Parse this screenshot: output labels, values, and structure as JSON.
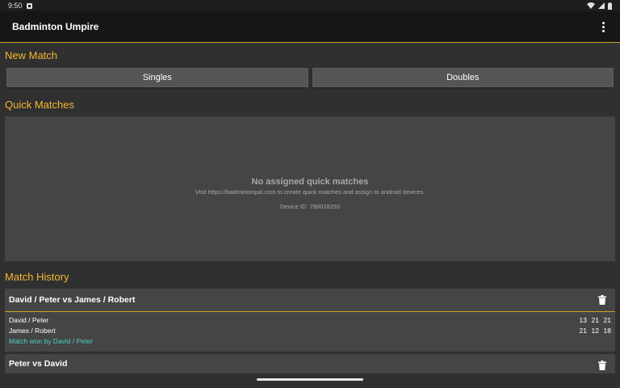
{
  "status": {
    "time": "9:50"
  },
  "app": {
    "title": "Badminton Umpire"
  },
  "new_match": {
    "heading": "New Match",
    "singles_label": "Singles",
    "doubles_label": "Doubles"
  },
  "quick_matches": {
    "heading": "Quick Matches",
    "empty_title": "No assigned quick matches",
    "empty_sub": "Visit https://badmintonpal.com to create quick matches and assign to android devices.",
    "device_id": "Device ID: 768018293"
  },
  "history": {
    "heading": "Match History",
    "matches": [
      {
        "title": "David / Peter vs James / Robert",
        "team1": "David / Peter",
        "team1_scores": [
          "13",
          "21",
          "21"
        ],
        "team2": "James / Robert",
        "team2_scores": [
          "21",
          "12",
          "18"
        ],
        "result": "Match won by David / Peter"
      },
      {
        "title": "Peter vs David"
      }
    ]
  },
  "colors": {
    "accent": "#f5b731",
    "winner": "#4fd1c5",
    "background": "#303030",
    "card": "#454545"
  }
}
